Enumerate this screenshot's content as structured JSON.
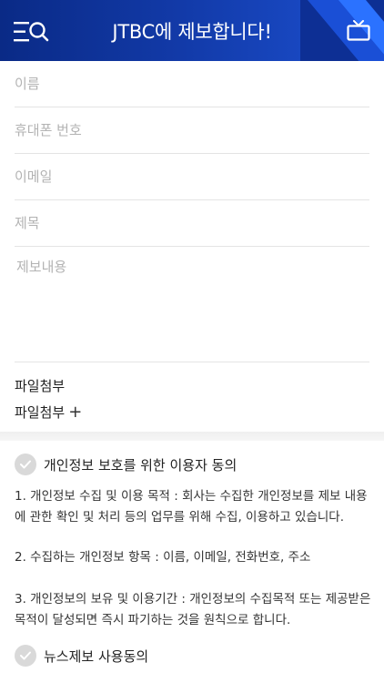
{
  "header": {
    "title": "JTBC에 제보합니다!",
    "menu_icon": "menu-search-icon",
    "tv_icon": "tv-icon",
    "colors": {
      "primary": "#0d2f94",
      "accent": "#2b72ff"
    }
  },
  "form": {
    "name_placeholder": "이름",
    "phone_placeholder": "휴대폰 번호",
    "email_placeholder": "이메일",
    "subject_placeholder": "제목",
    "content_placeholder": "제보내용"
  },
  "attachment": {
    "title": "파일첨부",
    "button_label": "파일첨부",
    "button_icon": "+"
  },
  "privacy_consent": {
    "label": "개인정보 보호를 위한 이용자 동의",
    "items": [
      "1. 개인정보 수집 및 이용 목적 : 회사는 수집한 개인정보를 제보 내용에 관한 확인 및 처리 등의 업무를 위해 수집, 이용하고 있습니다.",
      "2. 수집하는 개인정보 항목 : 이름, 이메일, 전화번호, 주소",
      "3. 개인정보의 보유 및 이용기간 : 개인정보의 수집목적 또는 제공받은 목적이 달성되면 즉시 파기하는 것을 원칙으로 합니다."
    ]
  },
  "news_consent": {
    "label": "뉴스제보 사용동의"
  }
}
